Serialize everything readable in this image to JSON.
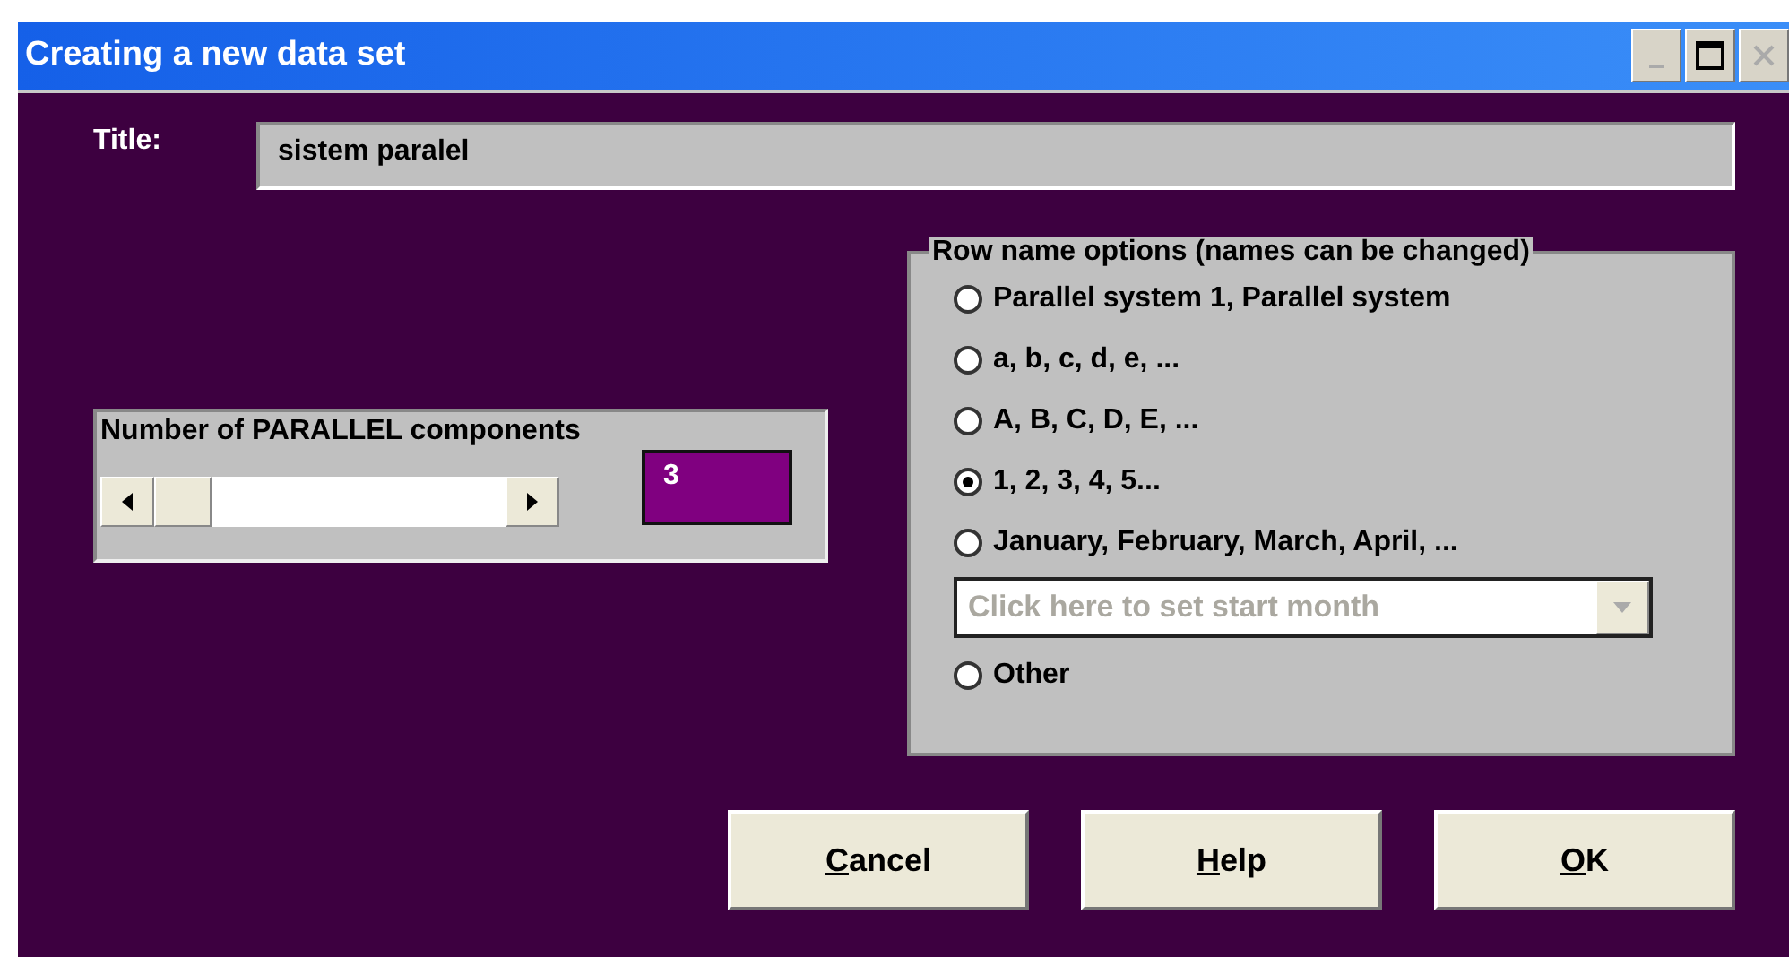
{
  "window": {
    "title": "Creating a new data set"
  },
  "title_field": {
    "label": "Title:",
    "value": "sistem paralel"
  },
  "components": {
    "label": "Number of PARALLEL components",
    "value": "3"
  },
  "row_names": {
    "legend": "Row name options (names can be changed)",
    "options": [
      {
        "label": "Parallel system 1, Parallel system",
        "selected": false
      },
      {
        "label": "a, b, c, d, e, ...",
        "selected": false
      },
      {
        "label": "A, B, C, D, E, ...",
        "selected": false
      },
      {
        "label": "1, 2, 3, 4, 5...",
        "selected": true
      },
      {
        "label": "January, February, March, April, ...",
        "selected": false
      },
      {
        "label": "Other",
        "selected": false
      }
    ],
    "month_select": {
      "placeholder": "Click here to set start month",
      "disabled": true
    }
  },
  "buttons": [
    {
      "label": "Cancel"
    },
    {
      "label": "Help"
    },
    {
      "label": "OK"
    }
  ]
}
